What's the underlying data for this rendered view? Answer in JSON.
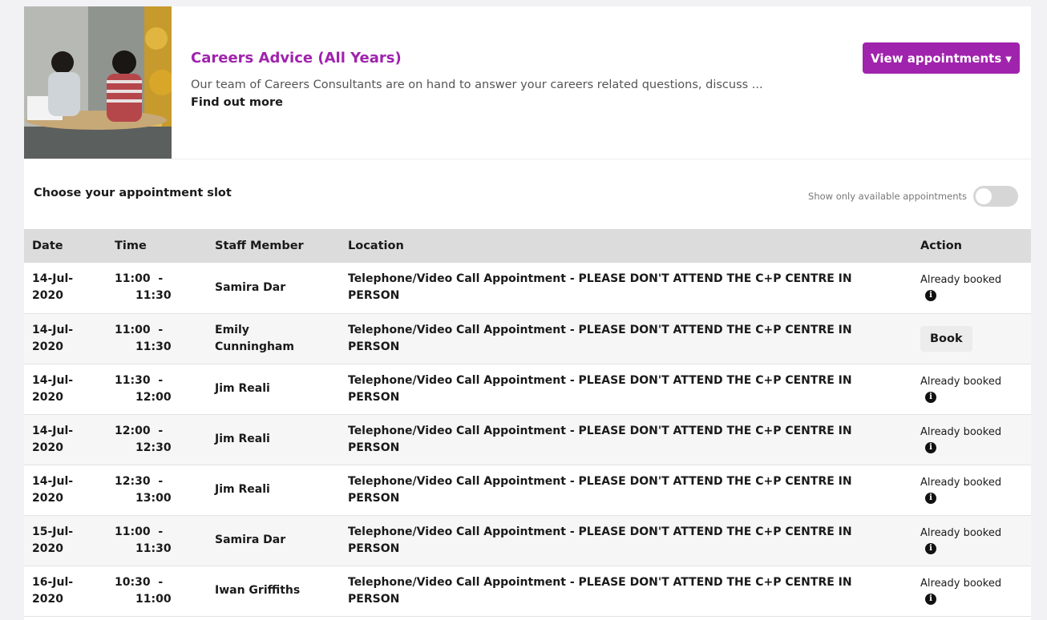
{
  "service": {
    "title": "Careers Advice (All Years)",
    "description": "Our team of Careers Consultants are on hand to answer your careers related questions, discuss ...",
    "find_out_more": "Find out more",
    "view_button": "View appointments"
  },
  "slots": {
    "heading": "Choose your appointment slot",
    "toggle_label": "Show only available appointments",
    "toggle_on": false
  },
  "table": {
    "headers": {
      "date": "Date",
      "time": "Time",
      "staff": "Staff Member",
      "location": "Location",
      "action": "Action"
    },
    "rows": [
      {
        "date": "14-Jul-2020",
        "time_start": "11:00",
        "time_end": "11:30",
        "staff": "Samira Dar",
        "location": "Telephone/Video Call Appointment - PLEASE DON'T ATTEND THE C+P CENTRE IN PERSON",
        "action": "Already booked"
      },
      {
        "date": "14-Jul-2020",
        "time_start": "11:00",
        "time_end": "11:30",
        "staff": "Emily Cunningham",
        "location": "Telephone/Video Call Appointment - PLEASE DON'T ATTEND THE C+P CENTRE IN PERSON",
        "action": "Book"
      },
      {
        "date": "14-Jul-2020",
        "time_start": "11:30",
        "time_end": "12:00",
        "staff": "Jim Reali",
        "location": "Telephone/Video Call Appointment - PLEASE DON'T ATTEND THE C+P CENTRE IN PERSON",
        "action": "Already booked"
      },
      {
        "date": "14-Jul-2020",
        "time_start": "12:00",
        "time_end": "12:30",
        "staff": "Jim Reali",
        "location": "Telephone/Video Call Appointment - PLEASE DON'T ATTEND THE C+P CENTRE IN PERSON",
        "action": "Already booked"
      },
      {
        "date": "14-Jul-2020",
        "time_start": "12:30",
        "time_end": "13:00",
        "staff": "Jim Reali",
        "location": "Telephone/Video Call Appointment - PLEASE DON'T ATTEND THE C+P CENTRE IN PERSON",
        "action": "Already booked"
      },
      {
        "date": "15-Jul-2020",
        "time_start": "11:00",
        "time_end": "11:30",
        "staff": "Samira Dar",
        "location": "Telephone/Video Call Appointment - PLEASE DON'T ATTEND THE C+P CENTRE IN PERSON",
        "action": "Already booked"
      },
      {
        "date": "16-Jul-2020",
        "time_start": "10:30",
        "time_end": "11:00",
        "staff": "Iwan Griffiths",
        "location": "Telephone/Video Call Appointment - PLEASE DON'T ATTEND THE C+P CENTRE IN PERSON",
        "action": "Already booked"
      }
    ]
  },
  "colors": {
    "accent": "#a023ad",
    "header_row": "#dcdcdc"
  }
}
